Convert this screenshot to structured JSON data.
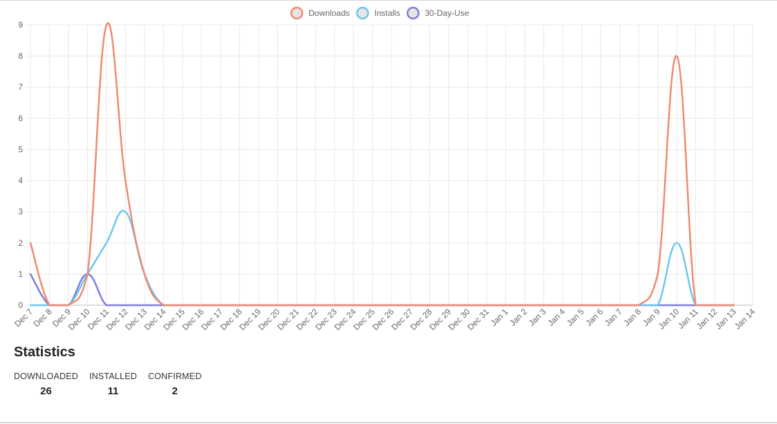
{
  "chart_data": {
    "type": "line",
    "categories": [
      "Dec 7",
      "Dec 8",
      "Dec 9",
      "Dec 10",
      "Dec 11",
      "Dec 12",
      "Dec 13",
      "Dec 14",
      "Dec 15",
      "Dec 16",
      "Dec 17",
      "Dec 18",
      "Dec 19",
      "Dec 20",
      "Dec 21",
      "Dec 22",
      "Dec 23",
      "Dec 24",
      "Dec 25",
      "Dec 26",
      "Dec 27",
      "Dec 28",
      "Dec 29",
      "Dec 30",
      "Dec 31",
      "Jan 1",
      "Jan 2",
      "Jan 3",
      "Jan 4",
      "Jan 5",
      "Jan 6",
      "Jan 7",
      "Jan 8",
      "Jan 9",
      "Jan 10",
      "Jan 11",
      "Jan 12",
      "Jan 13",
      "Jan 14"
    ],
    "series": [
      {
        "name": "Downloads",
        "color": "#f08a70",
        "values": [
          2,
          0,
          0,
          1,
          9,
          4,
          1,
          0,
          0,
          0,
          0,
          0,
          0,
          0,
          0,
          0,
          0,
          0,
          0,
          0,
          0,
          0,
          0,
          0,
          0,
          0,
          0,
          0,
          0,
          0,
          0,
          0,
          0,
          1,
          8,
          0,
          0,
          0
        ]
      },
      {
        "name": "Installs",
        "color": "#6ec6f0",
        "values": [
          0,
          0,
          0,
          1,
          2,
          3,
          1,
          0,
          0,
          0,
          0,
          0,
          0,
          0,
          0,
          0,
          0,
          0,
          0,
          0,
          0,
          0,
          0,
          0,
          0,
          0,
          0,
          0,
          0,
          0,
          0,
          0,
          0,
          0,
          2,
          0,
          0,
          0
        ]
      },
      {
        "name": "30-Day-Use",
        "color": "#7b7ddb",
        "values": [
          1,
          0,
          0,
          1,
          0,
          0,
          0,
          0,
          0,
          0,
          0,
          0,
          0,
          0,
          0,
          0,
          0,
          0,
          0,
          0,
          0,
          0,
          0,
          0,
          0,
          0,
          0,
          0,
          0,
          0,
          0,
          0,
          0,
          0,
          0,
          0,
          0,
          0
        ]
      }
    ],
    "ylim": [
      0,
      9
    ],
    "yticks": [
      0,
      1,
      2,
      3,
      4,
      5,
      6,
      7,
      8,
      9
    ],
    "grid": true,
    "legend_position": "top-center"
  },
  "statistics": {
    "title": "Statistics",
    "items": [
      {
        "label": "DOWNLOADED",
        "value": "26"
      },
      {
        "label": "INSTALLED",
        "value": "11"
      },
      {
        "label": "CONFIRMED",
        "value": "2"
      }
    ]
  }
}
